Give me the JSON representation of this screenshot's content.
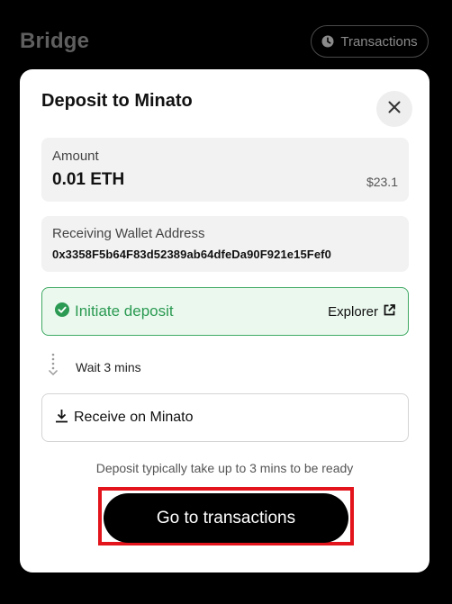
{
  "header": {
    "title": "Bridge",
    "transactions_label": "Transactions"
  },
  "dialog": {
    "title": "Deposit to Minato",
    "amount": {
      "label": "Amount",
      "value": "0.01 ETH",
      "usd": "$23.1"
    },
    "receiving_address": {
      "label": "Receiving Wallet Address",
      "value": "0x3358F5b64F83d52389ab64dfeDa90F921e15Fef0"
    },
    "steps": {
      "initiate": "Initiate deposit",
      "explorer": "Explorer",
      "wait": "Wait 3 mins",
      "receive": "Receive on Minato"
    },
    "note": "Deposit typically take up to 3 mins to be ready",
    "primary_button": "Go to transactions"
  },
  "colors": {
    "background": "#000000",
    "card": "#ffffff",
    "success": "#2b9a52",
    "success_bg": "#eaf8ee",
    "highlight": "#e3141b"
  },
  "icons": {
    "transactions": "clock-icon",
    "close": "close-icon",
    "initiate": "check-circle-icon",
    "explorer": "external-link-icon",
    "wait": "dotted-arrow-down-icon",
    "receive": "download-icon"
  }
}
